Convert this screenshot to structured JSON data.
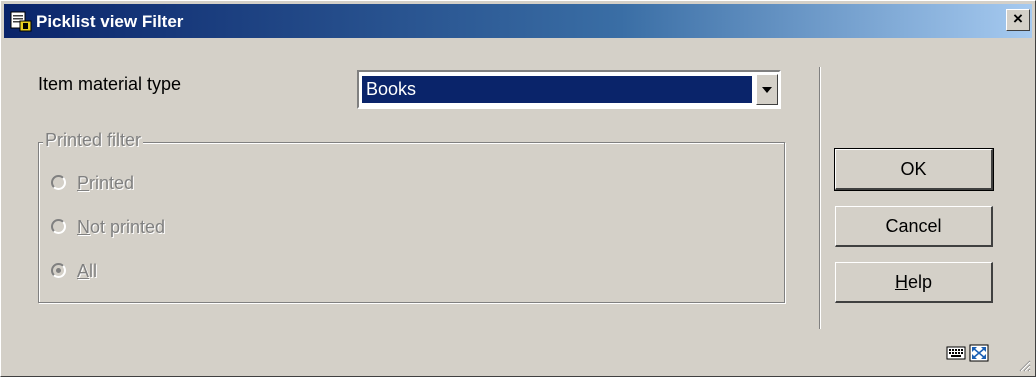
{
  "window": {
    "title": "Picklist view Filter",
    "close_label": "×"
  },
  "material": {
    "label": "Item material type",
    "selected": "Books"
  },
  "printed_filter": {
    "legend": "Printed filter",
    "options": [
      {
        "mnemonic": "P",
        "rest": "rinted",
        "checked": false
      },
      {
        "mnemonic": "N",
        "rest": "ot printed",
        "checked": false
      },
      {
        "mnemonic": "A",
        "rest": "ll",
        "checked": true
      }
    ]
  },
  "buttons": {
    "ok": "OK",
    "cancel": "Cancel",
    "help_mnemonic": "H",
    "help_rest": "elp"
  },
  "colors": {
    "title_bar": "#0a246a",
    "face": "#d4d0c8",
    "selection": "#0a246a"
  }
}
